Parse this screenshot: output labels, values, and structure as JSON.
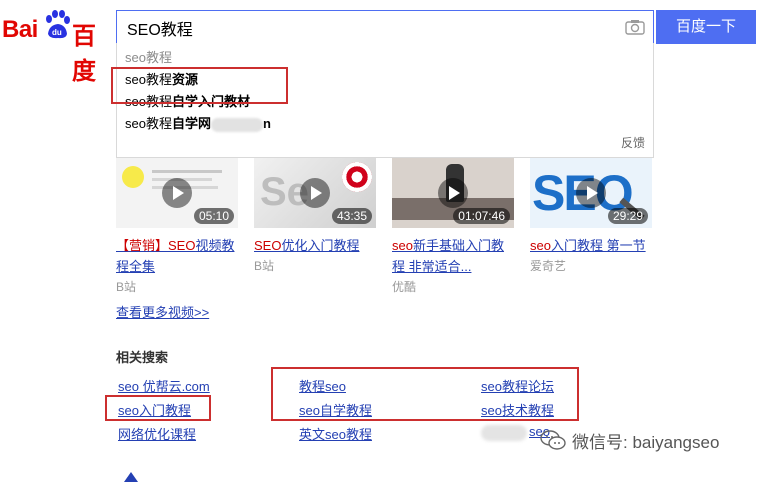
{
  "logo": {
    "part1": "Bai",
    "part2": "百度"
  },
  "search": {
    "value": "SEO教程",
    "button_label": "百度一下"
  },
  "suggestions": [
    {
      "text": "seo教程"
    },
    {
      "prefix": "seo教程",
      "bold": "资源"
    },
    {
      "prefix": "seo教程",
      "bold": "自学入门教材"
    },
    {
      "prefix": "seo教程",
      "bold": "自学网",
      "tail": "n"
    }
  ],
  "feedback_label": "反馈",
  "videos": [
    {
      "title_hl": "【营销】SEO",
      "title_rest": "视频教程全集",
      "source": "B站",
      "duration": "05:10"
    },
    {
      "title_hl": "SEO",
      "title_rest": "优化入门教程",
      "source": "B站",
      "duration": "43:35"
    },
    {
      "title_hl": "seo",
      "title_rest": "新手基础入门教程 非常适合...",
      "source": "优酷",
      "duration": "01:07:46"
    },
    {
      "title_hl": "seo",
      "title_rest": "入门教程 第一节",
      "source": "爱奇艺",
      "duration": "29:29"
    }
  ],
  "more_videos": "查看更多视频>>",
  "related": {
    "title": "相关搜索",
    "items": [
      "seo 优帮云.com",
      "seo入门教程",
      "网络优化课程",
      "教程seo",
      "seo自学教程",
      "英文seo教程",
      "seo教程论坛",
      "seo技术教程",
      "seo"
    ]
  },
  "watermark": "微信号: baiyangseo",
  "colors": {
    "brand_red": "#e10602",
    "brand_blue": "#4e6ef2",
    "link": "#2440b3",
    "highlight_box": "#cc2f2f"
  }
}
